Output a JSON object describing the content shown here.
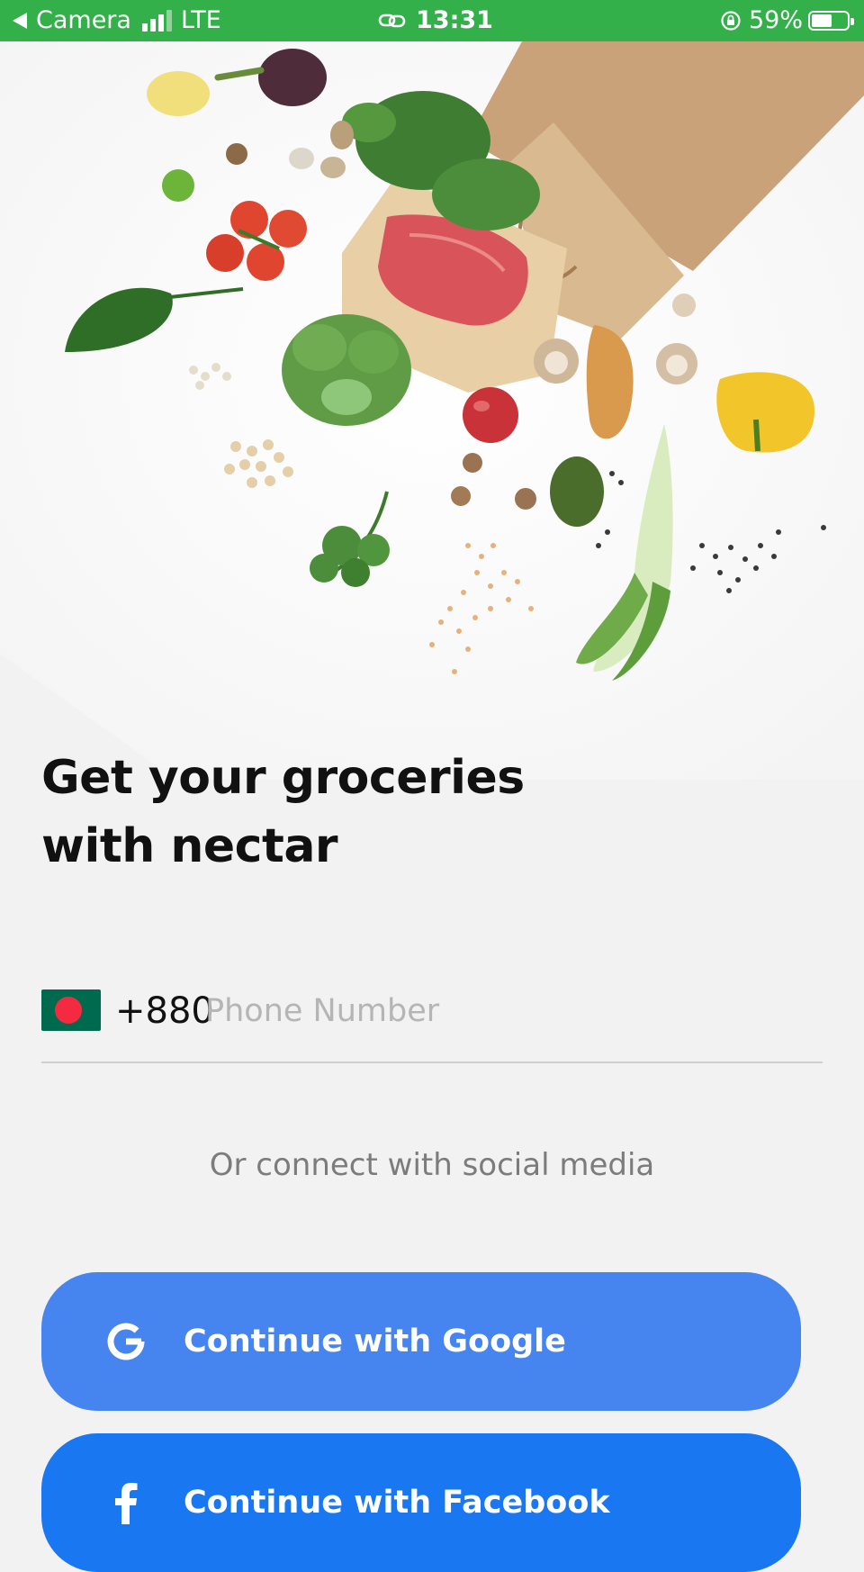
{
  "status_bar": {
    "back_app": "Camera",
    "network": "LTE",
    "time": "13:31",
    "battery_percent": "59%",
    "battery_level": 0.59
  },
  "hero": {
    "image": "grocery-bag-spill-illustration"
  },
  "title": {
    "line1": "Get your groceries",
    "line2": "with nectar"
  },
  "phone": {
    "country_flag": "bangladesh-flag",
    "country_code": "+880",
    "value": "",
    "placeholder": "Phone Number"
  },
  "social": {
    "label": "Or connect with social media",
    "google_label": "Continue with Google",
    "facebook_label": "Continue with Facebook"
  },
  "colors": {
    "status_bar": "#34b04a",
    "google_button": "#4684ef",
    "facebook_button": "#1a77f2",
    "background": "#f2f2f2"
  }
}
